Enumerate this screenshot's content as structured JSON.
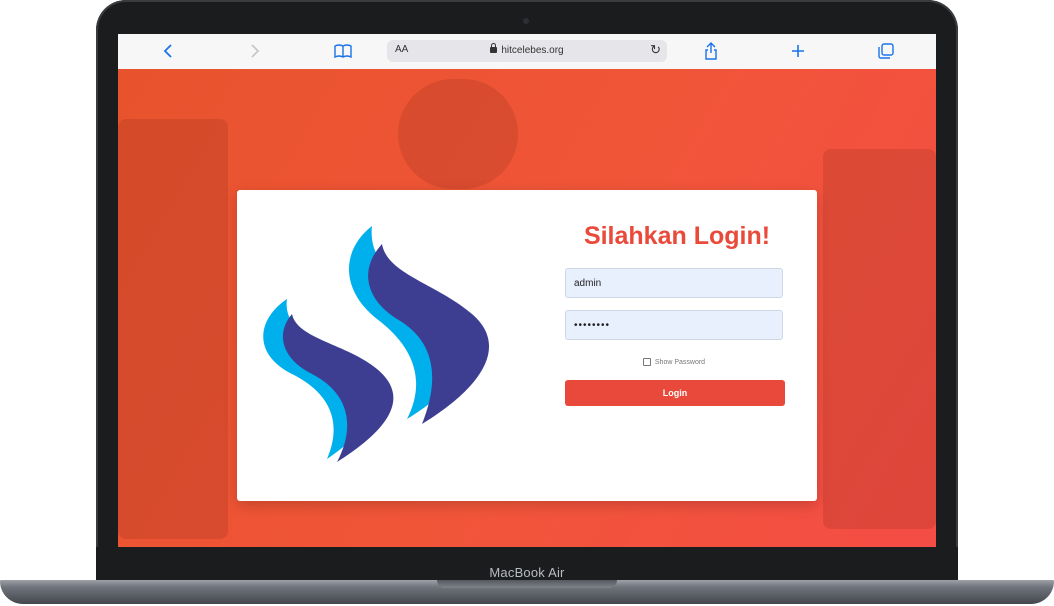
{
  "browser": {
    "text_size_label": "AA",
    "url": "hitcelebes.org",
    "back_icon": "chevron-left-icon",
    "forward_icon": "chevron-right-icon",
    "bookmarks_icon": "book-icon",
    "reload_icon": "reload-icon",
    "share_icon": "share-icon",
    "new_tab_icon": "plus-icon",
    "tabs_icon": "tabs-icon"
  },
  "login": {
    "title": "Silahkan Login!",
    "username_value": "admin",
    "password_value": "••••••••",
    "show_password_label": "Show Password",
    "login_button_label": "Login"
  },
  "device": {
    "model_label": "MacBook Air"
  },
  "colors": {
    "accent": "#e9493a",
    "logo_light": "#00b0ec",
    "logo_dark": "#3d3e92",
    "background": "#f15539"
  }
}
